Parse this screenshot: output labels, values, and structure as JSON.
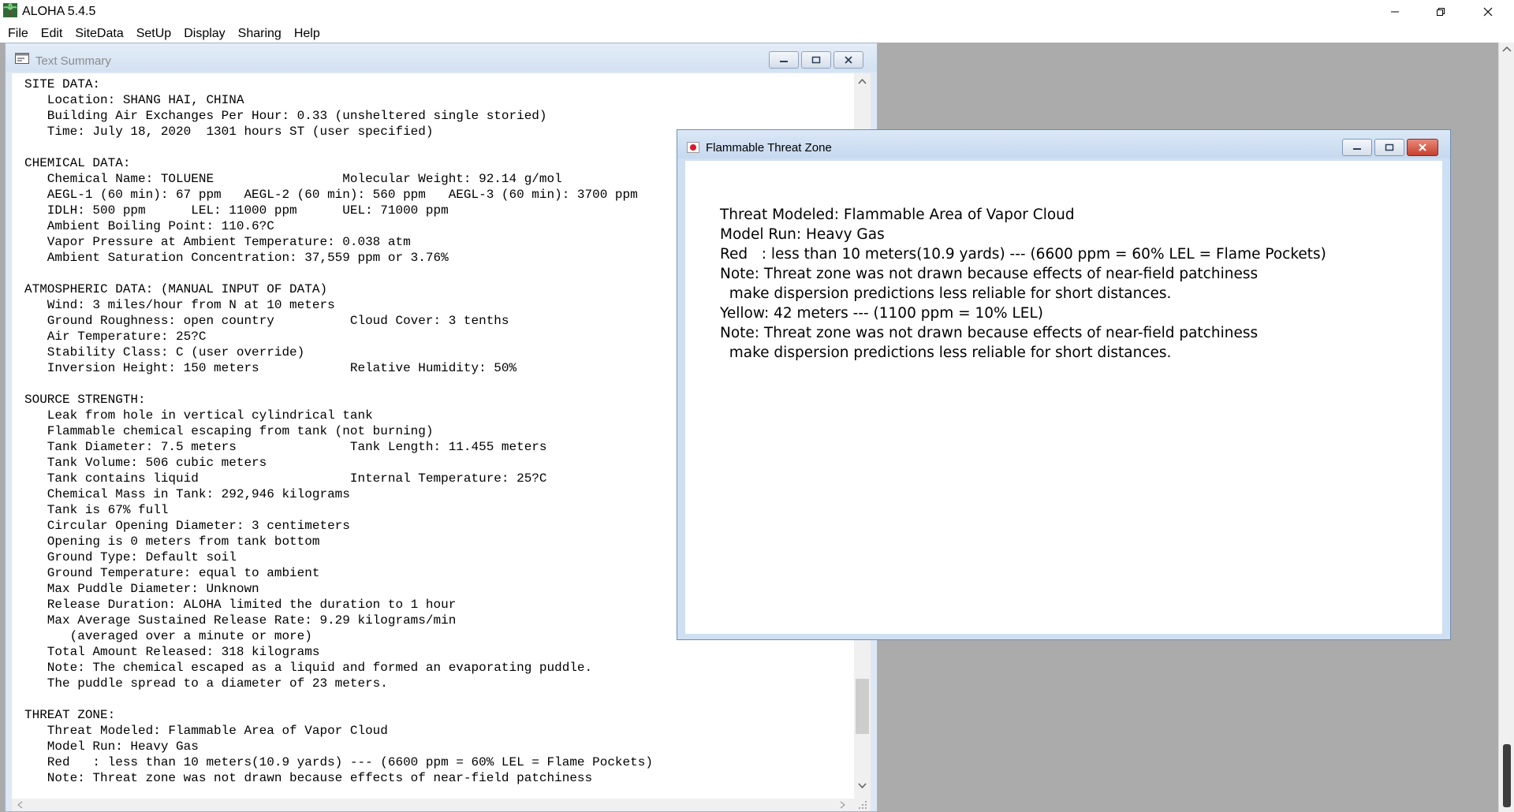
{
  "app": {
    "title": "ALOHA 5.4.5",
    "menu": [
      "File",
      "Edit",
      "SiteData",
      "SetUp",
      "Display",
      "Sharing",
      "Help"
    ]
  },
  "summary_window": {
    "title": "Text Summary",
    "lines": [
      "SITE DATA:",
      "   Location: SHANG HAI, CHINA",
      "   Building Air Exchanges Per Hour: 0.33 (unsheltered single storied)",
      "   Time: July 18, 2020  1301 hours ST (user specified)",
      "",
      "CHEMICAL DATA:",
      "   Chemical Name: TOLUENE                 Molecular Weight: 92.14 g/mol",
      "   AEGL-1 (60 min): 67 ppm   AEGL-2 (60 min): 560 ppm   AEGL-3 (60 min): 3700 ppm",
      "   IDLH: 500 ppm      LEL: 11000 ppm      UEL: 71000 ppm",
      "   Ambient Boiling Point: 110.6?C",
      "   Vapor Pressure at Ambient Temperature: 0.038 atm",
      "   Ambient Saturation Concentration: 37,559 ppm or 3.76%",
      "",
      "ATMOSPHERIC DATA: (MANUAL INPUT OF DATA)",
      "   Wind: 3 miles/hour from N at 10 meters",
      "   Ground Roughness: open country          Cloud Cover: 3 tenths",
      "   Air Temperature: 25?C",
      "   Stability Class: C (user override)",
      "   Inversion Height: 150 meters            Relative Humidity: 50%",
      "",
      "SOURCE STRENGTH:",
      "   Leak from hole in vertical cylindrical tank",
      "   Flammable chemical escaping from tank (not burning)",
      "   Tank Diameter: 7.5 meters               Tank Length: 11.455 meters",
      "   Tank Volume: 506 cubic meters",
      "   Tank contains liquid                    Internal Temperature: 25?C",
      "   Chemical Mass in Tank: 292,946 kilograms",
      "   Tank is 67% full",
      "   Circular Opening Diameter: 3 centimeters",
      "   Opening is 0 meters from tank bottom",
      "   Ground Type: Default soil",
      "   Ground Temperature: equal to ambient",
      "   Max Puddle Diameter: Unknown",
      "   Release Duration: ALOHA limited the duration to 1 hour",
      "   Max Average Sustained Release Rate: 9.29 kilograms/min",
      "      (averaged over a minute or more)",
      "   Total Amount Released: 318 kilograms",
      "   Note: The chemical escaped as a liquid and formed an evaporating puddle.",
      "   The puddle spread to a diameter of 23 meters.",
      "",
      "THREAT ZONE:",
      "   Threat Modeled: Flammable Area of Vapor Cloud",
      "   Model Run: Heavy Gas",
      "   Red   : less than 10 meters(10.9 yards) --- (6600 ppm = 60% LEL = Flame Pockets)",
      "   Note: Threat zone was not drawn because effects of near-field patchiness"
    ]
  },
  "threat_window": {
    "title": "Flammable Threat Zone",
    "lines": [
      "Threat Modeled: Flammable Area of Vapor Cloud",
      "Model Run: Heavy Gas",
      "Red   : less than 10 meters(10.9 yards) --- (6600 ppm = 60% LEL = Flame Pockets)",
      "Note: Threat zone was not drawn because effects of near-field patchiness",
      "  make dispersion predictions less reliable for short distances.",
      "Yellow: 42 meters --- (1100 ppm = 10% LEL)",
      "Note: Threat zone was not drawn because effects of near-field patchiness",
      "  make dispersion predictions less reliable for short distances."
    ]
  },
  "icons": {
    "app": "palm-tree-icon",
    "summary": "text-document-icon",
    "threat": "japan-flag-icon"
  },
  "colors": {
    "workspace": "#ababab",
    "window_frame": "#dde8f4",
    "close_red": "#c8402c"
  }
}
